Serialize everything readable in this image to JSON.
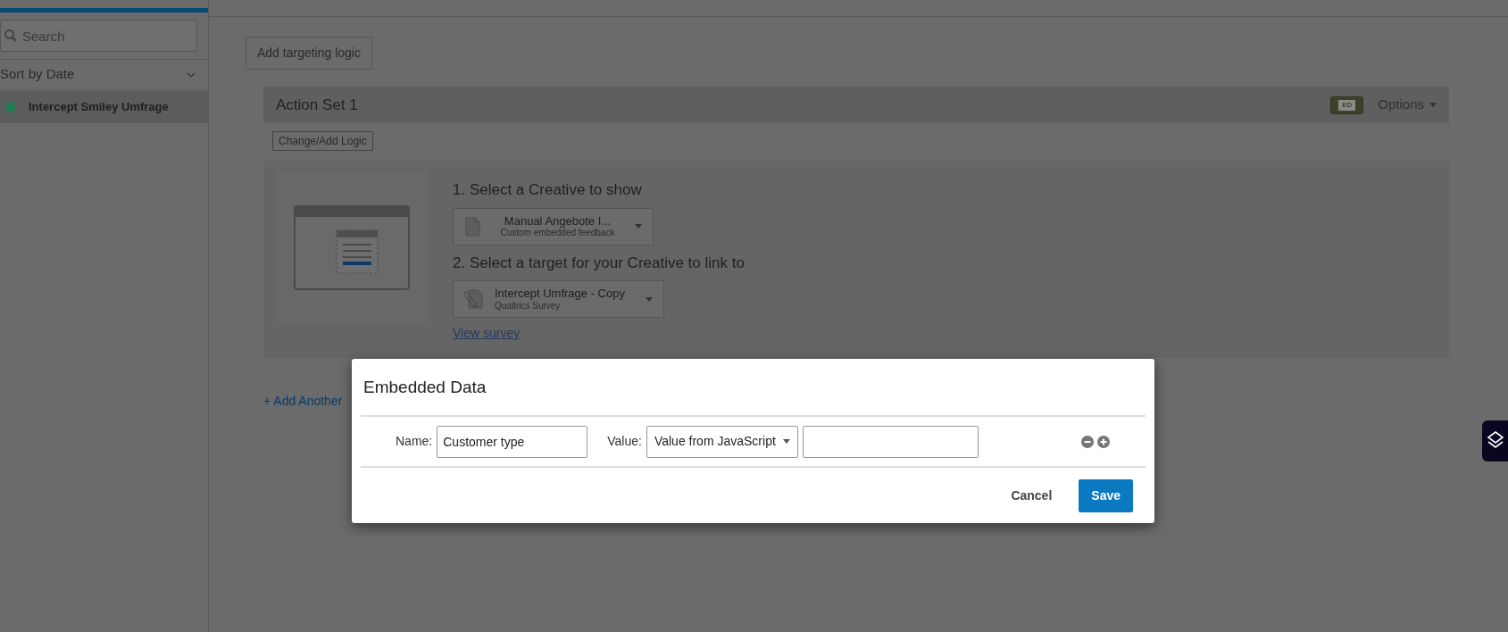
{
  "sidebar": {
    "search": {
      "placeholder": "Search"
    },
    "sort": {
      "label": "Sort by Date"
    },
    "items": [
      {
        "label": "Intercept Smiley Umfrage",
        "selected": true,
        "color": "#1f7a55"
      }
    ]
  },
  "main": {
    "add_logic_button": "Add targeting logic",
    "action_set": {
      "title": "Action Set 1",
      "badge": "ED",
      "options": "Options",
      "change_logic": "Change/Add Logic",
      "step1": "1. Select a Creative to show",
      "creative": {
        "title": "Manual Angebote I...",
        "subtitle": "Custom embedded feedback"
      },
      "step2": "2. Select a target for your Creative to link to",
      "target": {
        "title": "Intercept Umfrage - Copy",
        "subtitle": "Qualtrics Survey"
      },
      "link": "View survey"
    },
    "add_another": "+ Add Another"
  },
  "modal": {
    "title": "Embedded Data",
    "name_label": "Name:",
    "name_value": "Customer type",
    "value_label": "Value:",
    "value_type": "Value from JavaScript",
    "cancel": "Cancel",
    "save": "Save"
  }
}
